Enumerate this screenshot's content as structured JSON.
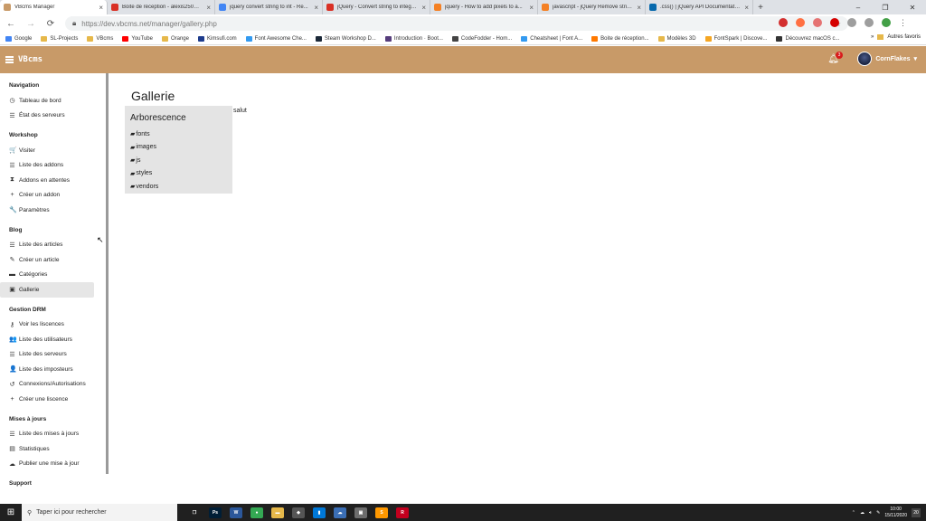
{
  "browser": {
    "tabs": [
      {
        "title": "VBcms Manager",
        "color": "#c89a68",
        "active": true
      },
      {
        "title": "Boite de réception - alexis250@...",
        "color": "#d93025"
      },
      {
        "title": "jquery convert string to int - Re...",
        "color": "#4285f4"
      },
      {
        "title": "jQuery - Convert string to intege...",
        "color": "#d93025"
      },
      {
        "title": "jquery - How to add pixels to a...",
        "color": "#f48024"
      },
      {
        "title": "javascript - jQuery Remove strin...",
        "color": "#f48024"
      },
      {
        "title": ".css() | jQuery API Documentatio...",
        "color": "#0769ad"
      }
    ],
    "newtab": "+",
    "window_controls": [
      "‒",
      "❐",
      "✕"
    ],
    "nav": {
      "back": "←",
      "forward": "→",
      "reload": "⟳"
    },
    "url_host": "https://dev.vbcms.net",
    "url_path": "/manager/gallery.php",
    "bookmarks": [
      {
        "label": "Google",
        "color": "#4285f4"
      },
      {
        "label": "SL-Projects",
        "color": "#e6b84a"
      },
      {
        "label": "VBcms",
        "color": "#e6b84a"
      },
      {
        "label": "YouTube",
        "color": "#ff0000"
      },
      {
        "label": "Orange",
        "color": "#e6b84a"
      },
      {
        "label": "Kimsufi.com",
        "color": "#1d3b8c"
      },
      {
        "label": "Font Awesome Che...",
        "color": "#339af0"
      },
      {
        "label": "Steam Workshop D...",
        "color": "#1b2838"
      },
      {
        "label": "Introduction · Boot...",
        "color": "#563d7c"
      },
      {
        "label": "CodeFodder - Hom...",
        "color": "#444444"
      },
      {
        "label": "Cheatsheet | Font A...",
        "color": "#339af0"
      },
      {
        "label": "Boite de réception...",
        "color": "#ff7900"
      },
      {
        "label": "Modèles 3D",
        "color": "#e6b84a"
      },
      {
        "label": "FontSpark | Discove...",
        "color": "#f5a623"
      },
      {
        "label": "Découvrez macOS c...",
        "color": "#333333"
      }
    ],
    "bookmarks_more": "»",
    "other_bookmarks": "Autres favoris"
  },
  "app": {
    "brand": "VBcms",
    "notifications_count": "3",
    "user_name": "CornFlakes",
    "user_caret": "▾",
    "accent_color": "#c89a68"
  },
  "sidebar": {
    "sections": [
      {
        "title": "Navigation",
        "items": [
          {
            "label": "Tableau de bord",
            "icon": "tachometer-icon",
            "glyph": "◷"
          },
          {
            "label": "État des serveurs",
            "icon": "list-icon",
            "glyph": "☰"
          }
        ]
      },
      {
        "title": "Workshop",
        "items": [
          {
            "label": "Visiter",
            "icon": "cart-icon",
            "glyph": "🛒"
          },
          {
            "label": "Liste des addons",
            "icon": "list-icon",
            "glyph": "☰"
          },
          {
            "label": "Addons en attentes",
            "icon": "hourglass-icon",
            "glyph": "⧗"
          },
          {
            "label": "Créer un addon",
            "icon": "plus-icon",
            "glyph": "+"
          },
          {
            "label": "Paramètres",
            "icon": "wrench-icon",
            "glyph": "🔧"
          }
        ]
      },
      {
        "title": "Blog",
        "items": [
          {
            "label": "Liste des articles",
            "icon": "list-icon",
            "glyph": "☰"
          },
          {
            "label": "Créer un article",
            "icon": "pencil-icon",
            "glyph": "✎"
          },
          {
            "label": "Catégories",
            "icon": "folder-icon",
            "glyph": "▬"
          },
          {
            "label": "Gallerie",
            "icon": "images-icon",
            "glyph": "▣",
            "active": true
          }
        ]
      },
      {
        "title": "Gestion DRM",
        "items": [
          {
            "label": "Voir les liscences",
            "icon": "key-icon",
            "glyph": "⚷"
          },
          {
            "label": "Liste des utilisateurs",
            "icon": "users-icon",
            "glyph": "👥"
          },
          {
            "label": "Liste des serveurs",
            "icon": "list-icon",
            "glyph": "☰"
          },
          {
            "label": "Liste des imposteurs",
            "icon": "user-slash-icon",
            "glyph": "👤"
          },
          {
            "label": "Connexions/Autorisations",
            "icon": "history-icon",
            "glyph": "↺"
          },
          {
            "label": "Créer une liscence",
            "icon": "plus-icon",
            "glyph": "+"
          }
        ]
      },
      {
        "title": "Mises à jours",
        "items": [
          {
            "label": "Liste des mises à jours",
            "icon": "list-icon",
            "glyph": "☰"
          },
          {
            "label": "Statistiques",
            "icon": "chart-icon",
            "glyph": "▤"
          },
          {
            "label": "Publier une mise à jour",
            "icon": "cloud-upload-icon",
            "glyph": "☁"
          }
        ]
      },
      {
        "title": "Support",
        "items": []
      }
    ]
  },
  "main": {
    "title": "Gallerie",
    "salut": "salut",
    "tree": {
      "title": "Arborescence",
      "folders": [
        "fonts",
        "images",
        "js",
        "styles",
        "vendors"
      ]
    }
  },
  "taskbar": {
    "search_placeholder": "Taper ici pour rechercher",
    "apps": [
      {
        "name": "task-view",
        "color": "#202020",
        "label": "❐"
      },
      {
        "name": "photoshop",
        "color": "#001e36",
        "label": "Ps"
      },
      {
        "name": "word",
        "color": "#2b579a",
        "label": "W"
      },
      {
        "name": "chrome",
        "color": "#34a853",
        "label": "●"
      },
      {
        "name": "explorer",
        "color": "#e6b84a",
        "label": "▬"
      },
      {
        "name": "store",
        "color": "#555555",
        "label": "◆"
      },
      {
        "name": "notes",
        "color": "#0078d7",
        "label": "▮"
      },
      {
        "name": "cloud",
        "color": "#3b6fb6",
        "label": "☁"
      },
      {
        "name": "photos",
        "color": "#6d6d6d",
        "label": "▣"
      },
      {
        "name": "sublime",
        "color": "#ff9800",
        "label": "S"
      },
      {
        "name": "rider",
        "color": "#c3001e",
        "label": "R"
      }
    ],
    "time": "10:00",
    "date": "15/11/2020",
    "notifications": "20"
  }
}
